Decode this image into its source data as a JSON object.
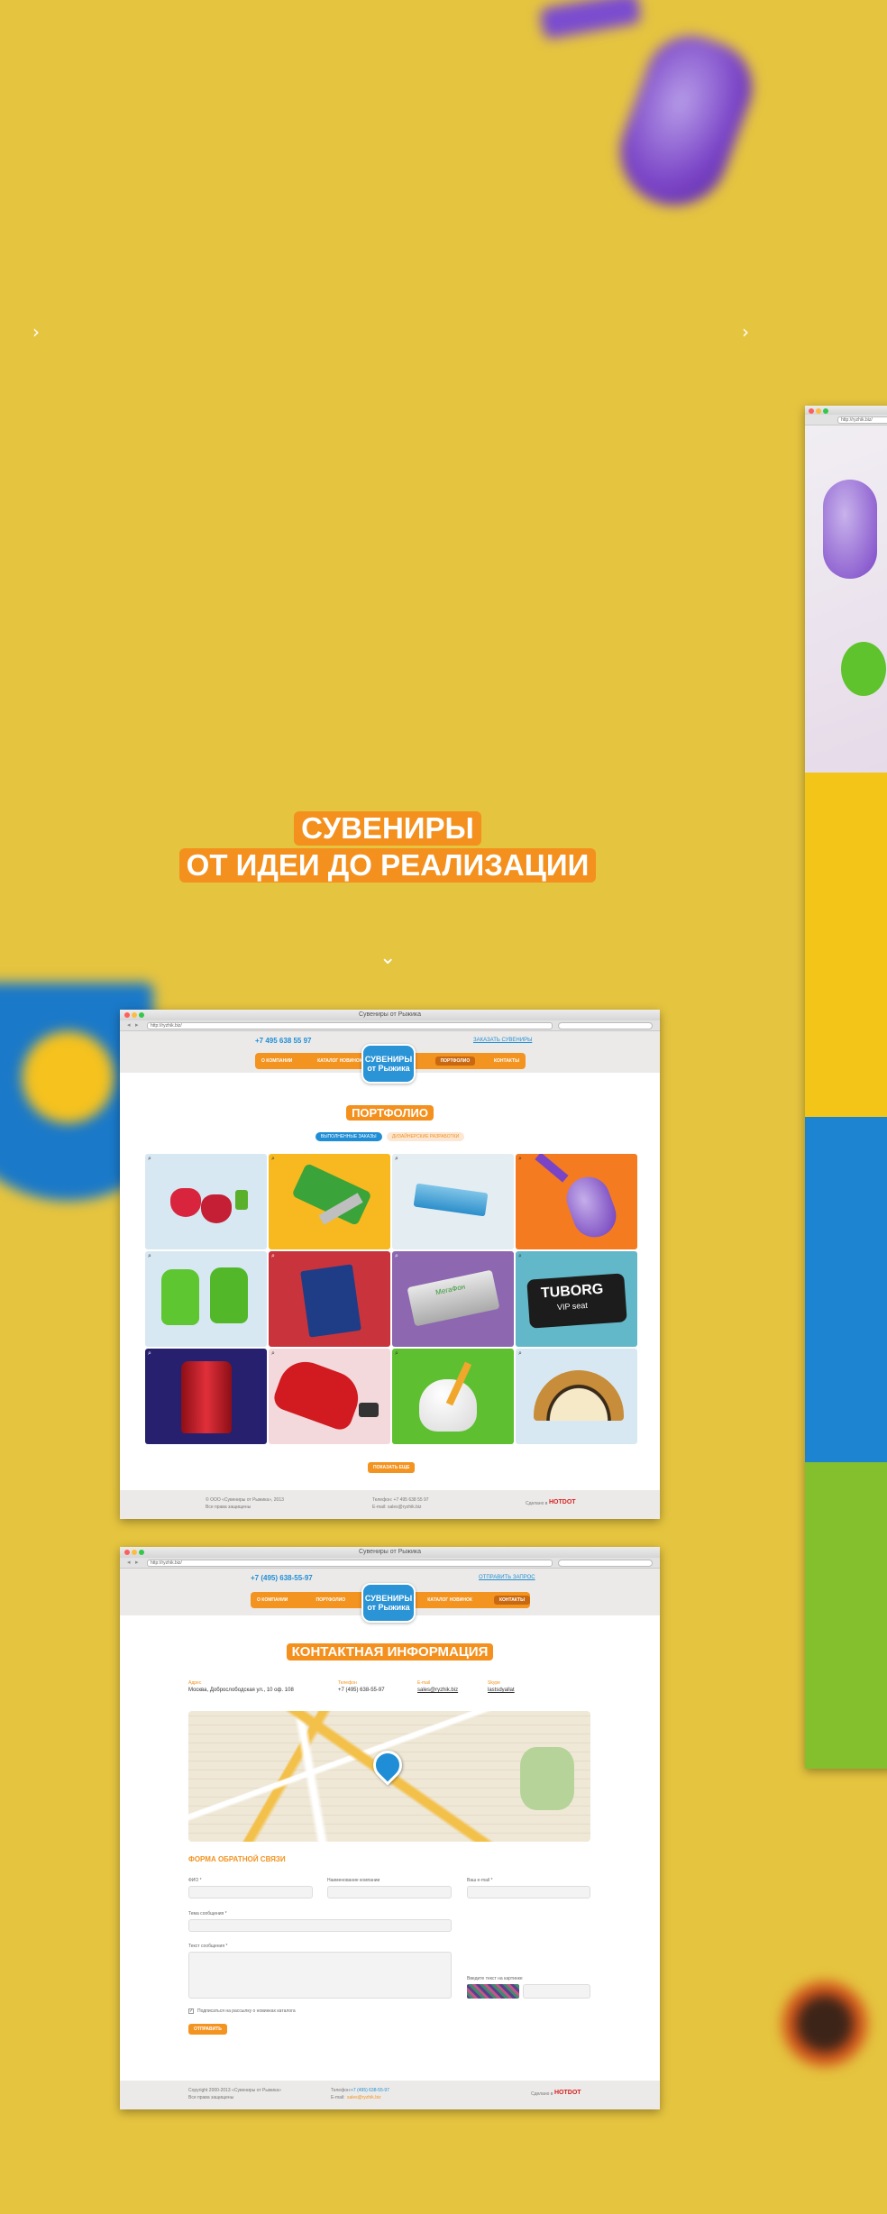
{
  "hero": {
    "line1": "СУВЕНИРЫ",
    "line2": "ОТ ИДЕИ ДО РЕАЛИЗАЦИИ",
    "arrow_left": "›",
    "arrow_right": "›",
    "scroll_down": "⌄"
  },
  "colors": {
    "background": "#e5c43f",
    "accent": "#f4901d",
    "brand_blue": "#1f8ed6"
  },
  "right_window": {
    "url": "http://ryzhik.biz/"
  },
  "window1": {
    "title": "Сувениры от Рыжика",
    "url": "http://ryzhik.biz/",
    "phone": "+7 495 638 55 97",
    "order_link": "ЗАКАЗАТЬ СУВЕНИРЫ",
    "logo": "СУВЕНИРЫ от Рыжика",
    "menu": [
      "О КОМПАНИИ",
      "КАТАЛОГ НОВИНОК",
      "ПОРТФОЛИО",
      "КОНТАКТЫ"
    ],
    "active_menu": "ПОРТФОЛИО",
    "section_title": "ПОРТФОЛИО",
    "tabs": [
      "ВЫПОЛНЕННЫЕ ЗАКАЗЫ",
      "ДИЗАЙНЕРСКИЕ РАЗРАБОТКИ"
    ],
    "items": [
      {
        "name": "strawberries",
        "bg": "#d7e8f2",
        "icon": "zoom-icon"
      },
      {
        "name": "multitool",
        "bg": "#f7b91f",
        "icon": "zoom-icon"
      },
      {
        "name": "usb-case",
        "bg": "#e3edf2",
        "icon": "zoom-icon"
      },
      {
        "name": "mouse",
        "bg": "#f47b20",
        "icon": "zoom-icon"
      },
      {
        "name": "gloves",
        "bg": "#d7e8f2",
        "icon": "zoom-icon"
      },
      {
        "name": "notebook",
        "bg": "#c9343c",
        "icon": "zoom-icon"
      },
      {
        "name": "megafon",
        "bg": "#8d67b0",
        "icon": "zoom-icon"
      },
      {
        "name": "tuborg",
        "bg": "#62b8c8",
        "icon": "zoom-icon"
      },
      {
        "name": "kettle",
        "bg": "#27206e",
        "icon": "zoom-icon"
      },
      {
        "name": "car",
        "bg": "#f3d9dc",
        "icon": "zoom-icon"
      },
      {
        "name": "tooth",
        "bg": "#5ec030",
        "icon": "zoom-icon"
      },
      {
        "name": "fan",
        "bg": "#d7e8f2",
        "icon": "zoom-icon"
      }
    ],
    "tuborg_text": "TUBORG",
    "tuborg_sub": "VIP seat",
    "megafon_text": "МегаФон",
    "more_button": "ПОКАЗАТЬ ЕЩЕ",
    "footer_copy": "© ООО «Сувениры от Рыжика», 2013",
    "footer_rights": "Все права защищены",
    "footer_phone": "Телефон: +7 495 638 55 97",
    "footer_email": "E-mail: sales@ryzhik.biz",
    "footer_made": "Сделано в",
    "footer_brand": "HOTDOT"
  },
  "window2": {
    "title": "Сувениры от Рыжика",
    "url": "http://ryzhik.biz/",
    "phone": "+7 (495) 638-55-97",
    "order_link": "ОТПРАВИТЬ ЗАПРОС",
    "logo": "СУВЕНИРЫ от Рыжика",
    "menu": [
      "О КОМПАНИИ",
      "ПОРТФОЛИО",
      "КАТАЛОГ НОВИНОК",
      "КОНТАКТЫ"
    ],
    "active_menu": "КОНТАКТЫ",
    "section_title": "КОНТАКТНАЯ ИНФОРМАЦИЯ",
    "contacts": [
      {
        "title": "Адрес",
        "value": "Москва, Доброслободская ул., 10 оф. 108"
      },
      {
        "title": "Телефон",
        "value": "+7 (495) 638-55-97"
      },
      {
        "title": "E-mail",
        "value": "sales@ryzhik.biz"
      },
      {
        "title": "Skype",
        "value": "lastsdyallat"
      }
    ],
    "form_title": "ФОРМА ОБРАТНОЙ СВЯЗИ",
    "labels": {
      "fio": "ФИО *",
      "company": "Наименование компании",
      "email": "Ваш e-mail *",
      "subject": "Тема сообщения *",
      "message": "Текст сообщения *",
      "captcha": "Введите текст на картинке"
    },
    "subscribe": "Подписаться на рассылку о новинках каталога",
    "submit": "ОТПРАВИТЬ",
    "footer_copy": "Copyright 2000-2013 «Сувениры от Рыжика»",
    "footer_rights": "Все права защищены",
    "footer_phone_label": "Телефон:",
    "footer_phone": "+7 (495) 638-55-97",
    "footer_email_label": "E-mail:",
    "footer_email": "sales@ryzhik.biz",
    "footer_made": "Сделано в",
    "footer_brand": "HOTDOT"
  }
}
